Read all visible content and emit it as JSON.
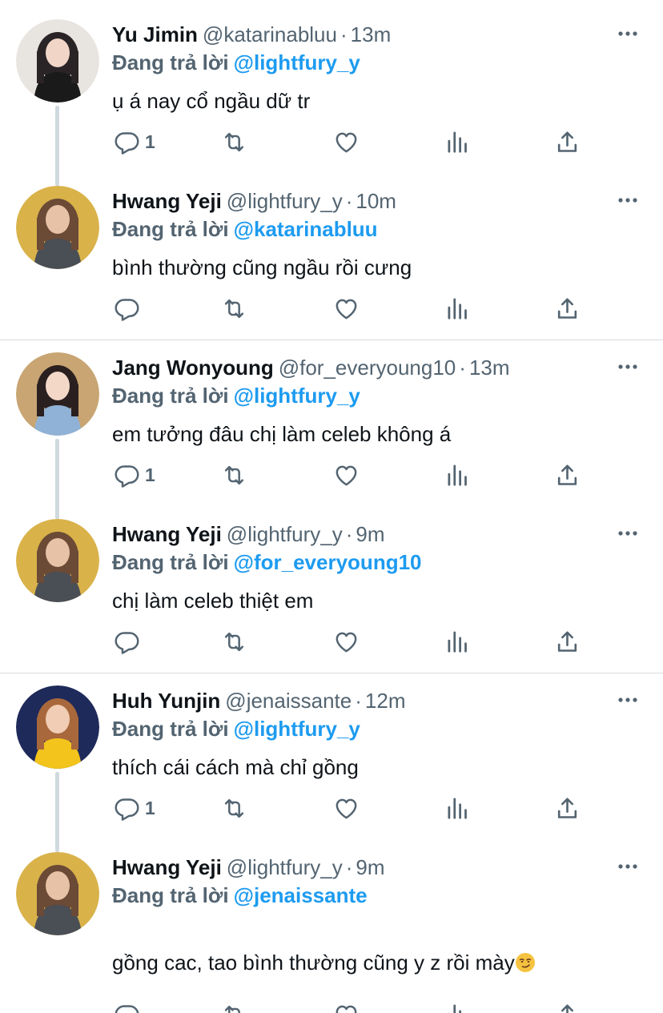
{
  "tweets": [
    {
      "name": "Yu Jimin",
      "handle": "@katarinabluu",
      "separator": "·",
      "time": "13m",
      "reply_label": "Đang trả lời",
      "reply_to": "@lightfury_y",
      "text": "ụ á nay cổ ngầu dữ tr",
      "reply_count": "1",
      "avatar_palette": {
        "bg": "#e8e4e0",
        "hair": "#2a2426",
        "skin": "#f1d6c8",
        "top": "#1a1a1a"
      }
    },
    {
      "name": "Hwang Yeji",
      "handle": "@lightfury_y",
      "separator": "·",
      "time": "10m",
      "reply_label": "Đang trả lời",
      "reply_to": "@katarinabluu",
      "text": "bình thường cũng ngầu rồi cưng",
      "reply_count": "",
      "avatar_palette": {
        "bg": "#d9b24a",
        "hair": "#6b4a36",
        "skin": "#e8c2a6",
        "top": "#4a4e55"
      }
    },
    {
      "name": "Jang Wonyoung",
      "handle": "@for_everyoung10",
      "separator": "·",
      "time": "13m",
      "reply_label": "Đang trả lời",
      "reply_to": "@lightfury_y",
      "text": "em tưởng đâu chị làm celeb không á",
      "reply_count": "1",
      "avatar_palette": {
        "bg": "#c8a572",
        "hair": "#2b2020",
        "skin": "#f3d8c8",
        "top": "#8fb2d6"
      }
    },
    {
      "name": "Hwang Yeji",
      "handle": "@lightfury_y",
      "separator": "·",
      "time": "9m",
      "reply_label": "Đang trả lời",
      "reply_to": "@for_everyoung10",
      "text": "chị làm celeb thiệt em",
      "reply_count": "",
      "avatar_palette": {
        "bg": "#d9b24a",
        "hair": "#6b4a36",
        "skin": "#e8c2a6",
        "top": "#4a4e55"
      }
    },
    {
      "name": "Huh Yunjin",
      "handle": "@jenaissante",
      "separator": "·",
      "time": "12m",
      "reply_label": "Đang trả lời",
      "reply_to": "@lightfury_y",
      "text": "thích cái cách mà chỉ gồng",
      "reply_count": "1",
      "avatar_palette": {
        "bg": "#1e2a5a",
        "hair": "#a8683c",
        "skin": "#f0cdb4",
        "top": "#f2c41c"
      }
    },
    {
      "name": "Hwang Yeji",
      "handle": "@lightfury_y",
      "separator": "·",
      "time": "9m",
      "reply_label": "Đang trả lời",
      "reply_to": "@jenaissante",
      "text": "gồng cac, tao bình thường cũng y z rồi mày",
      "text_emoji": "smirk-emoji",
      "reply_count": "",
      "avatar_palette": {
        "bg": "#d9b24a",
        "hair": "#6b4a36",
        "skin": "#e8c2a6",
        "top": "#4a4e55"
      }
    }
  ],
  "icons": {
    "more": "more-horizontal-icon",
    "reply": "comment-icon",
    "retweet": "retweet-icon",
    "like": "heart-icon",
    "views": "views-chart-icon",
    "share": "share-icon"
  },
  "colors": {
    "text": "#0f1419",
    "secondary": "#536471",
    "accent": "#1d9bf0",
    "thread_line": "#cfd9de",
    "divider": "#d6dadd"
  }
}
